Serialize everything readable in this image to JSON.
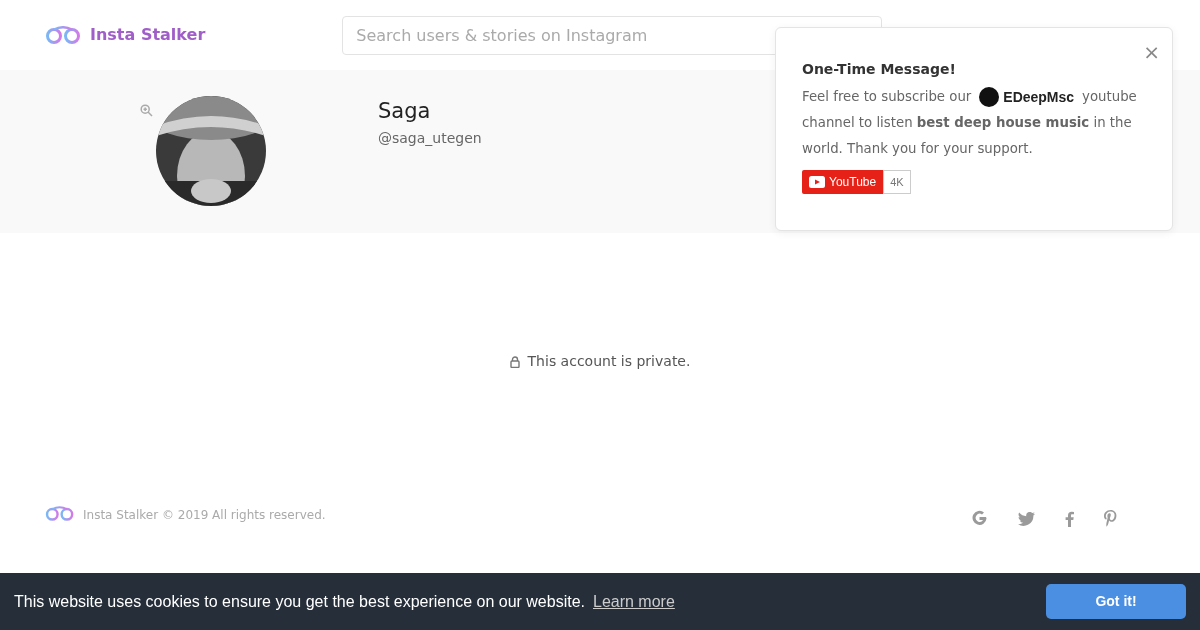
{
  "brand": {
    "name": "Insta Stalker"
  },
  "search": {
    "placeholder": "Search users & stories on Instagram"
  },
  "profile": {
    "name": "Saga",
    "handle": "@saga_utegen"
  },
  "private_notice": "This account is private.",
  "footer": {
    "copyright": "Insta Stalker © 2019 All rights reserved."
  },
  "popup": {
    "title": "One-Time Message!",
    "text_before": "Feel free to subscribe our",
    "channel": "EDeepMsc",
    "text_mid": "youtube",
    "text_after": "channel to listen **best deep house music** in the world. Thank you for your support.",
    "youtube_label": "YouTube",
    "subscriber_count": "4K",
    "close": "×"
  },
  "cookie_bar": {
    "message": "This website uses cookies to ensure you get the best experience on our website.",
    "link": "Learn more",
    "button": "Got it!"
  }
}
